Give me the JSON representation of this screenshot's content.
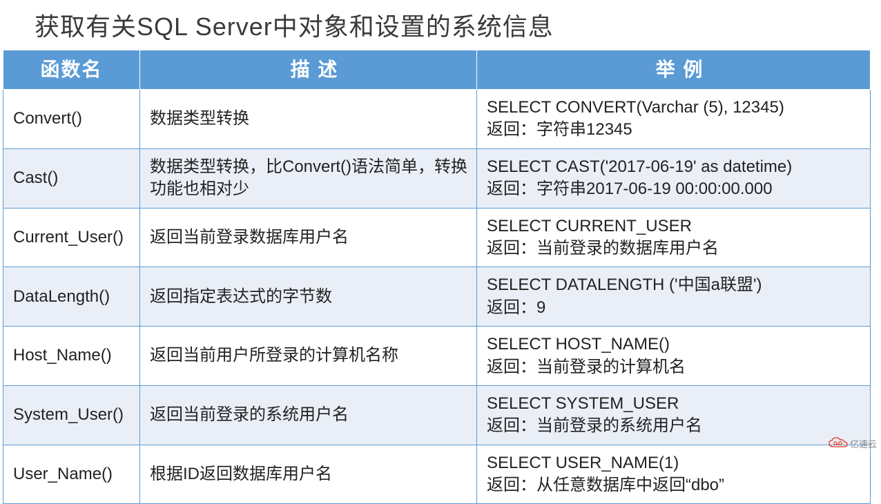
{
  "title": "获取有关SQL Server中对象和设置的系统信息",
  "headers": {
    "col1": "函数名",
    "col2": "描    述",
    "col3": "举    例"
  },
  "rows": [
    {
      "name": "Convert()",
      "desc": "数据类型转换",
      "example": "SELECT CONVERT(Varchar (5), 12345)\n返回：字符串12345"
    },
    {
      "name": "Cast()",
      "desc": "数据类型转换，比Convert()语法简单，转换功能也相对少",
      "example": "SELECT CAST('2017-06-19'   as datetime)\n返回：字符串2017-06-19 00:00:00.000"
    },
    {
      "name": "Current_User()",
      "desc": "返回当前登录数据库用户名",
      "example": "SELECT CURRENT_USER\n返回：当前登录的数据库用户名"
    },
    {
      "name": "DataLength()",
      "desc": "返回指定表达式的字节数",
      "example": "SELECT DATALENGTH ('中国a联盟')\n返回：9"
    },
    {
      "name": "Host_Name()",
      "desc": "返回当前用户所登录的计算机名称",
      "example": "SELECT HOST_NAME()\n返回：当前登录的计算机名"
    },
    {
      "name": "System_User()",
      "desc": "返回当前登录的系统用户名",
      "example": "SELECT SYSTEM_USER\n返回：当前登录的系统用户名"
    },
    {
      "name": "User_Name()",
      "desc": "根据ID返回数据库用户名",
      "example": "SELECT USER_NAME(1)\n返回：从任意数据库中返回“dbo”"
    }
  ],
  "logo_text": "亿速云"
}
